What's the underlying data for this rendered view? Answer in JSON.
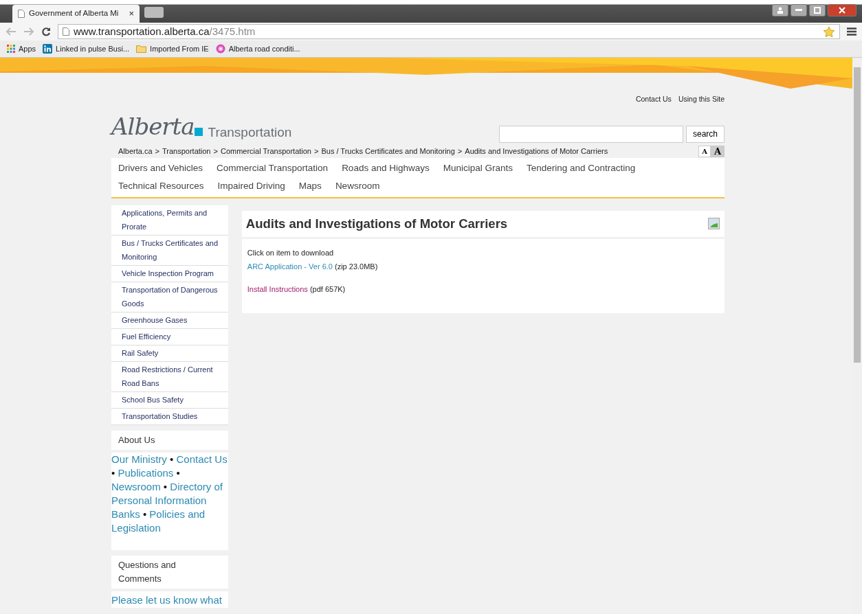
{
  "browser": {
    "tab_title": "Government of Alberta Mi",
    "tab_close": "×",
    "url_host": "www.transportation.alberta.ca",
    "url_path": "/3475.htm",
    "bookmarks": [
      {
        "kind": "apps",
        "label": "Apps"
      },
      {
        "kind": "linkedin",
        "label": "Linked in pulse Busi..."
      },
      {
        "kind": "folder",
        "label": "Imported From IE"
      },
      {
        "kind": "flower",
        "label": "Alberta road conditi..."
      }
    ]
  },
  "utility_links": [
    "Contact Us",
    "Using this Site"
  ],
  "logo": {
    "script": "Alberta",
    "subtitle": "Transportation"
  },
  "search": {
    "button": "search"
  },
  "breadcrumb": {
    "separator": ">",
    "items": [
      "Alberta.ca",
      "Transportation",
      "Commercial Transportation",
      "Bus / Trucks Certificates and Monitoring",
      "Audits and Investigations of Motor Carriers"
    ]
  },
  "text_size_buttons": [
    {
      "label": "A",
      "selected": false
    },
    {
      "label": "A",
      "selected": true
    }
  ],
  "main_nav": [
    "Drivers and Vehicles",
    "Commercial Transportation",
    "Roads and Highways",
    "Municipal Grants",
    "Tendering and Contracting",
    "Technical Resources",
    "Impaired Driving",
    "Maps",
    "Newsroom"
  ],
  "sidebar": {
    "items": [
      "Applications, Permits and Prorate",
      "Bus / Trucks Certificates and Monitoring",
      "Vehicle Inspection Program",
      "Transportation of Dangerous Goods",
      "Greenhouse Gases",
      "Fuel Efficiency",
      "Rail Safety",
      "Road Restrictions / Current Road Bans",
      "School Bus Safety",
      "Transportation Studies"
    ],
    "about": {
      "heading": "About Us",
      "separator": "•",
      "links": [
        "Our Ministry",
        "Contact Us",
        "Publications",
        "Newsroom",
        "Directory of Personal Information Banks",
        "Policies and Legislation"
      ]
    },
    "questions": {
      "heading": "Questions and Comments",
      "link": "Please let us know what"
    }
  },
  "content": {
    "title": "Audits and Investigations of Motor Carriers",
    "intro": "Click on item to download",
    "downloads": [
      {
        "link": "ARC Application - Ver 6.0",
        "info": "(zip 23.0MB)",
        "visited": false
      },
      {
        "link": "Install Instructions",
        "info": "(pdf 657K)",
        "visited": true
      }
    ]
  }
}
